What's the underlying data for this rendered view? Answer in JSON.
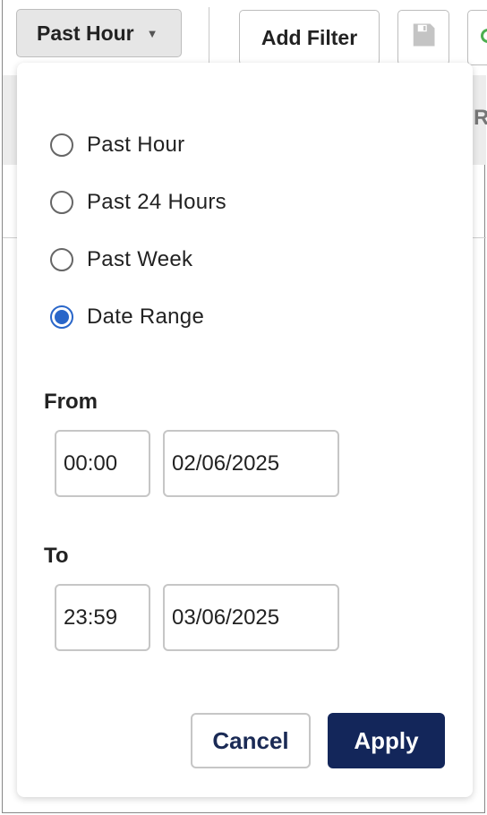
{
  "toolbar": {
    "range_button_label": "Past Hour",
    "add_filter_label": "Add Filter"
  },
  "background": {
    "partial_letter": "R"
  },
  "dropdown": {
    "options": [
      {
        "label": "Past Hour",
        "checked": false
      },
      {
        "label": "Past 24 Hours",
        "checked": false
      },
      {
        "label": "Past Week",
        "checked": false
      },
      {
        "label": "Date Range",
        "checked": true
      }
    ],
    "from": {
      "label": "From",
      "time": "00:00",
      "date": "02/06/2025"
    },
    "to": {
      "label": "To",
      "time": "23:59",
      "date": "03/06/2025"
    },
    "cancel_label": "Cancel",
    "apply_label": "Apply"
  },
  "colors": {
    "accent": "#2966c9",
    "apply_bg": "#13265a",
    "cancel_text": "#1a2a55"
  }
}
